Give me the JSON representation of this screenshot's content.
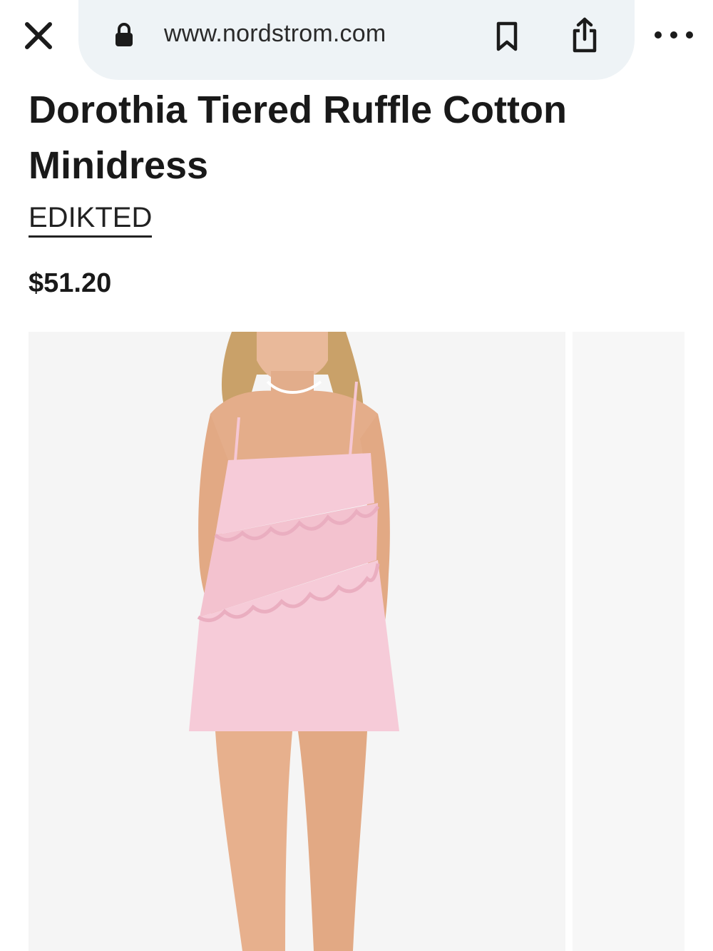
{
  "browser": {
    "url": "www.nordstrom.com"
  },
  "product": {
    "title": "Dorothia Tiered Ruffle Cotton Minidress",
    "brand": "EDIKTED",
    "price": "$51.20"
  },
  "icons": [
    "close-icon",
    "lock-icon",
    "bookmark-icon",
    "share-icon",
    "more-icon"
  ],
  "colors": {
    "dress": "#f5c7d4",
    "gallery_bg": "#f5f5f5",
    "url_bar": "#eef3f6"
  }
}
